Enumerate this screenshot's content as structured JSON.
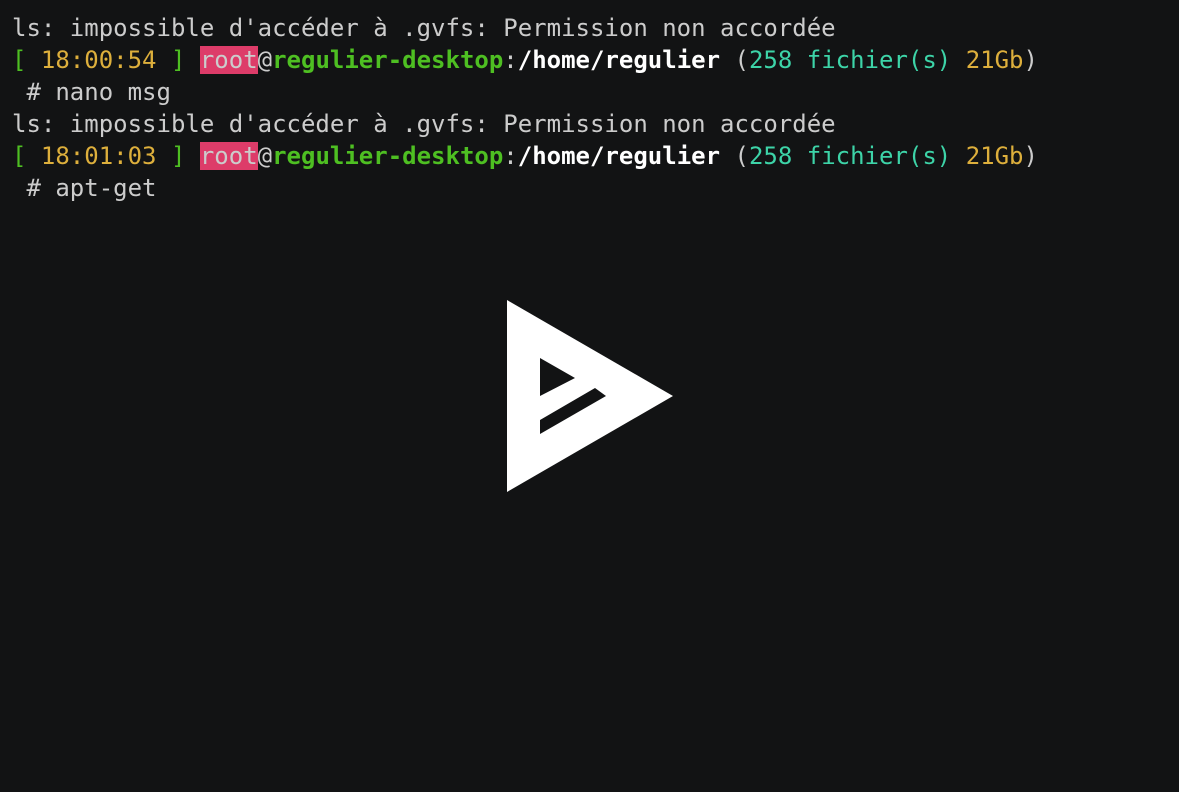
{
  "terminal": {
    "lines": [
      {
        "type": "error",
        "text": "ls: impossible d'accéder à .gvfs: Permission non accordée"
      },
      {
        "type": "prompt",
        "bracket_open": "[ ",
        "time": "18:00:54",
        "bracket_close": " ]",
        "user": "root",
        "at": "@",
        "host": "regulier-desktop",
        "colon": ":",
        "path": "/home/regulier",
        "paren_open": " (",
        "files": "258 fichier(s)",
        "size": " 21Gb",
        "paren_close": ")"
      },
      {
        "type": "command",
        "text": " # nano msg"
      },
      {
        "type": "error",
        "text": "ls: impossible d'accéder à .gvfs: Permission non accordée"
      },
      {
        "type": "prompt",
        "bracket_open": "[ ",
        "time": "18:01:03",
        "bracket_close": " ]",
        "user": "root",
        "at": "@",
        "host": "regulier-desktop",
        "colon": ":",
        "path": "/home/regulier",
        "paren_open": " (",
        "files": "258 fichier(s)",
        "size": " 21Gb",
        "paren_close": ")"
      },
      {
        "type": "command",
        "text": " # apt-get"
      }
    ]
  },
  "overlay": {
    "icon": "asciinema-play-icon"
  },
  "colors": {
    "background": "#121314",
    "foreground": "#cccccc",
    "green": "#4ebf22",
    "yellow": "#ddaf3c",
    "cyan": "#3dd4a8",
    "user_bg": "#dd3c69",
    "white": "#ffffff"
  }
}
